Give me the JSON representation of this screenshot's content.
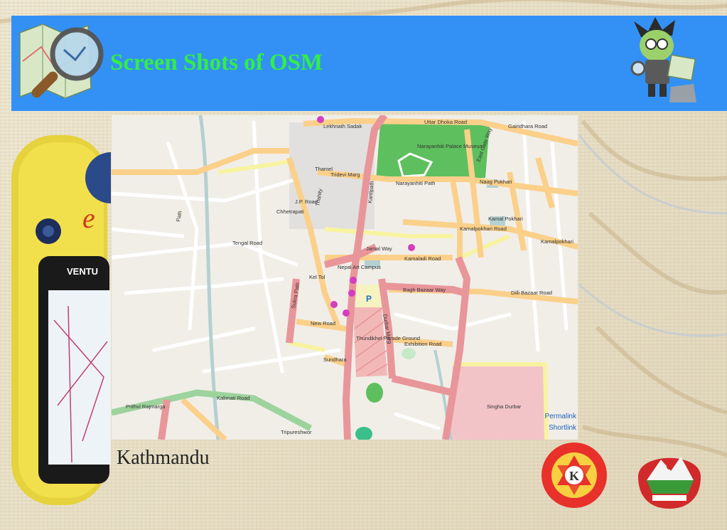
{
  "slide": {
    "title": "Screen Shots of OSM",
    "caption": "Kathmandu"
  },
  "colors": {
    "header": "#3391f5",
    "title": "#33ee44",
    "background": "#e9e1cb",
    "map_bg": "#f1eee8",
    "major_road": "#e8969a",
    "secondary_road": "#fbd08a",
    "tertiary_road": "#f7f3a0",
    "park": "#5ebf5e",
    "trunk_road": "#9dd39d",
    "river": "#b5d0d0",
    "parking": "#f7f3c0"
  },
  "icons": {
    "logo": "osm-magnifier-logo-icon",
    "mascot": "mapper-mascot-icon",
    "gps": "gps-device-icon",
    "emblem1": "kathmandu-university-emblem-icon",
    "emblem2": "nepal-coat-of-arms-icon"
  },
  "map": {
    "roads": [
      "Lekhnath Sadak",
      "Uttar Dhoka Road",
      "Gairidhara Road",
      "Tridevi Marg",
      "Narayanhiti Path",
      "East Gate Way",
      "Kamalpokhari Road",
      "Kamalpokhari",
      "Jamal Way",
      "Kamaladi Road",
      "Bagh Bazaar Way",
      "Dilli Bazaar Road",
      "New Road",
      "Exhibition Road",
      "Prithvi Rajmarga",
      "Kalimati Road",
      "Tripureshwor",
      "Sukra Path",
      "Tengal Road",
      "Durbar Marg",
      "Kantipath",
      "Chhetrapati",
      "J.P. Road",
      "Thahity",
      "Path"
    ],
    "places": [
      "Narayanhiti Palace Museum",
      "Nepal Art Campus",
      "Thundikhel Parade Ground",
      "Singha Durbar",
      "Naag Pokhari",
      "Kamal Pokhari",
      "Thamel",
      "Kel Tol",
      "Sundhara",
      "P"
    ],
    "links": [
      "Permalink",
      "Shortlink"
    ]
  }
}
